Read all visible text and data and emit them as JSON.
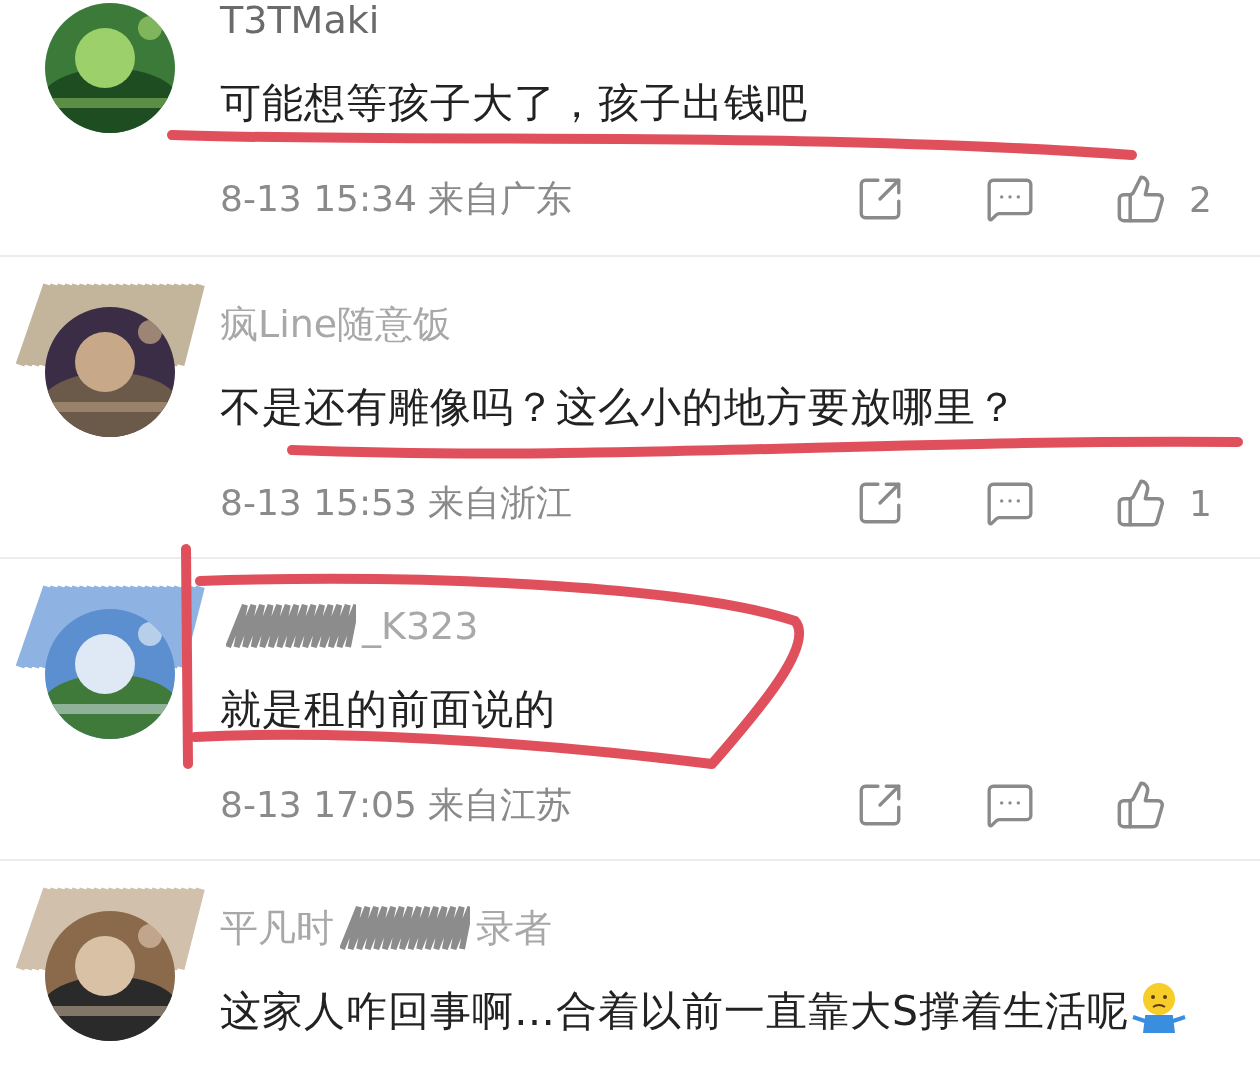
{
  "comments": [
    {
      "name_parts": [
        "T3TMaki"
      ],
      "text": "可能想等孩子大了，孩子出钱吧",
      "time": "8-13 15:34",
      "location": "来自广东",
      "likes": "2",
      "annotation": {
        "kind": "underline"
      }
    },
    {
      "name_parts": [
        "疯Line随意饭"
      ],
      "name_faded": true,
      "avatar_scribbled": true,
      "text": "不是还有雕像吗？这么小的地方要放哪里？",
      "time": "8-13 15:53",
      "location": "来自浙江",
      "likes": "1",
      "annotation": {
        "kind": "underline2"
      }
    },
    {
      "name_parts": [
        "_K323"
      ],
      "name_faded": true,
      "scribble_lead": true,
      "avatar_scribbled": true,
      "text": "就是租的前面说的",
      "time": "8-13 17:05",
      "location": "来自江苏",
      "annotation": {
        "kind": "loop"
      }
    },
    {
      "name_parts": [
        "平凡时",
        "录者"
      ],
      "name_faded": true,
      "avatar_scribbled": true,
      "text": "这家人咋回事啊…合着以前一直靠大S撑着生活呢",
      "trailing_emoji": true
    }
  ]
}
